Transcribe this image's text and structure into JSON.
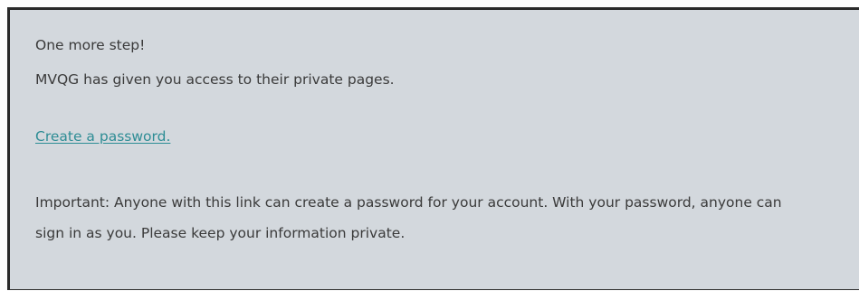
{
  "message": {
    "heading": "One more step!",
    "access_text": "MVQG has given you access to their private pages.",
    "create_password_link": "Create a password.",
    "important_notice": "Important: Anyone with this link can create a password for your account. With your password, anyone can sign in as you. Please keep your information private."
  },
  "colors": {
    "panel_background": "#d3d8dd",
    "text": "#3a3a3a",
    "link": "#2e8d95",
    "border": "#2b2b2b"
  }
}
